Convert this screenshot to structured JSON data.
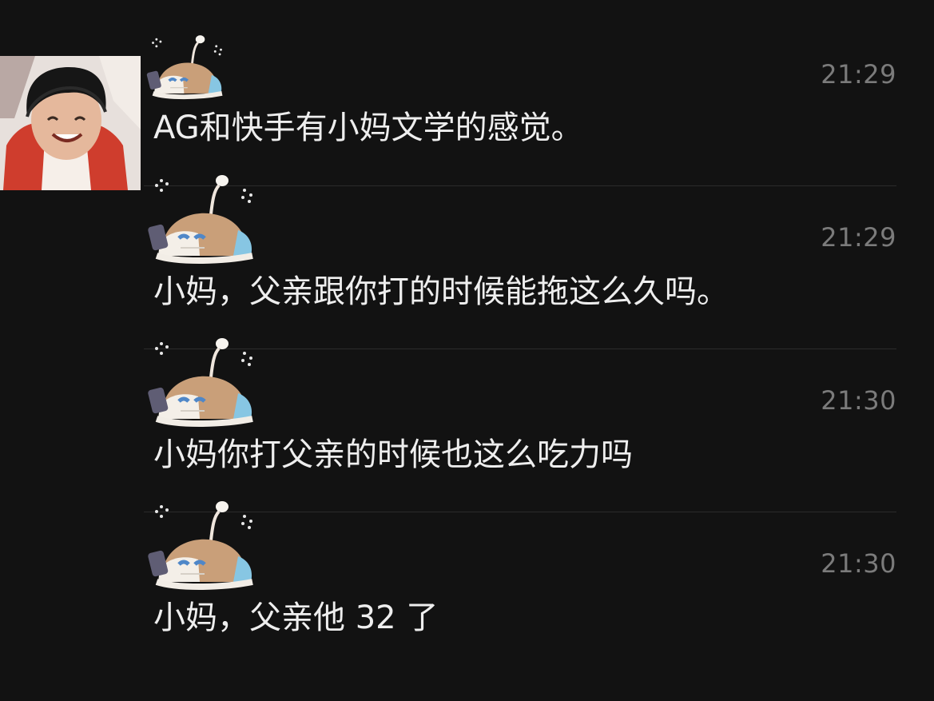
{
  "chat": {
    "messages": [
      {
        "time": "21:29",
        "text": "AG和快手有小妈文学的感觉。"
      },
      {
        "time": "21:29",
        "text": "小妈，父亲跟你打的时候能拖这么久吗。"
      },
      {
        "time": "21:30",
        "text": "小妈你打父亲的时候也这么吃力吗"
      },
      {
        "time": "21:30",
        "text": "小妈，父亲他 32 了"
      }
    ]
  },
  "icons": {
    "avatar": "user-photo-avatar",
    "sticker": "sleeping-cat-with-phone-sticker"
  },
  "colors": {
    "background": "#121212",
    "text": "#eeeeee",
    "timestamp": "#7b7b7b",
    "divider": "#2b2b2b"
  }
}
